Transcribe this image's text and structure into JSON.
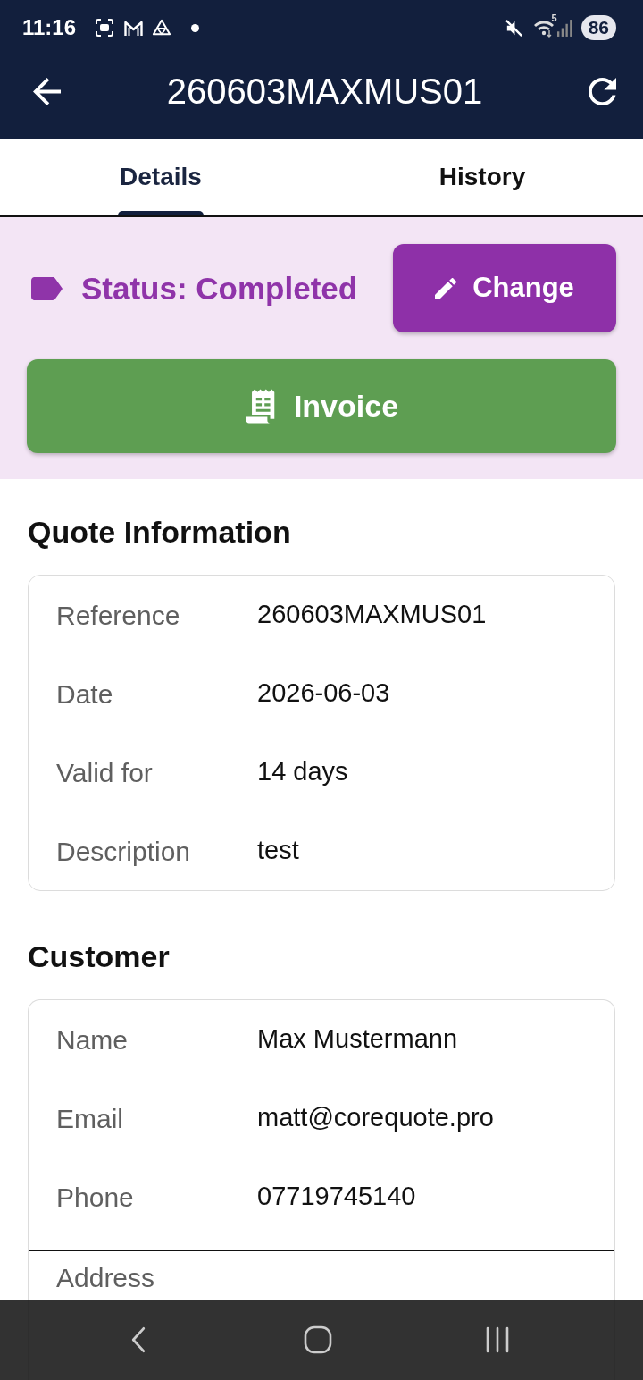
{
  "status_bar": {
    "time": "11:16",
    "wifi_band": "5",
    "battery": "86"
  },
  "app_bar": {
    "title": "260603MAXMUS01"
  },
  "tabs": [
    {
      "label": "Details",
      "selected": true
    },
    {
      "label": "History",
      "selected": false
    }
  ],
  "status_panel": {
    "status": "Status: Completed",
    "change_button": "Change",
    "invoice_button": "Invoice"
  },
  "sections": [
    {
      "title": "Quote Information",
      "rows": [
        {
          "label": "Reference",
          "value": "260603MAXMUS01"
        },
        {
          "label": "Date",
          "value": "2026-06-03"
        },
        {
          "label": "Valid for",
          "value": "14 days"
        },
        {
          "label": "Description",
          "value": "test"
        }
      ]
    },
    {
      "title": "Customer",
      "rows": [
        {
          "label": "Name",
          "value": "Max Mustermann"
        },
        {
          "label": "Email",
          "value": "matt@corequote.pro"
        },
        {
          "label": "Phone",
          "value": "07719745140"
        }
      ],
      "more_rows": [
        {
          "label": "Address"
        }
      ]
    }
  ]
}
